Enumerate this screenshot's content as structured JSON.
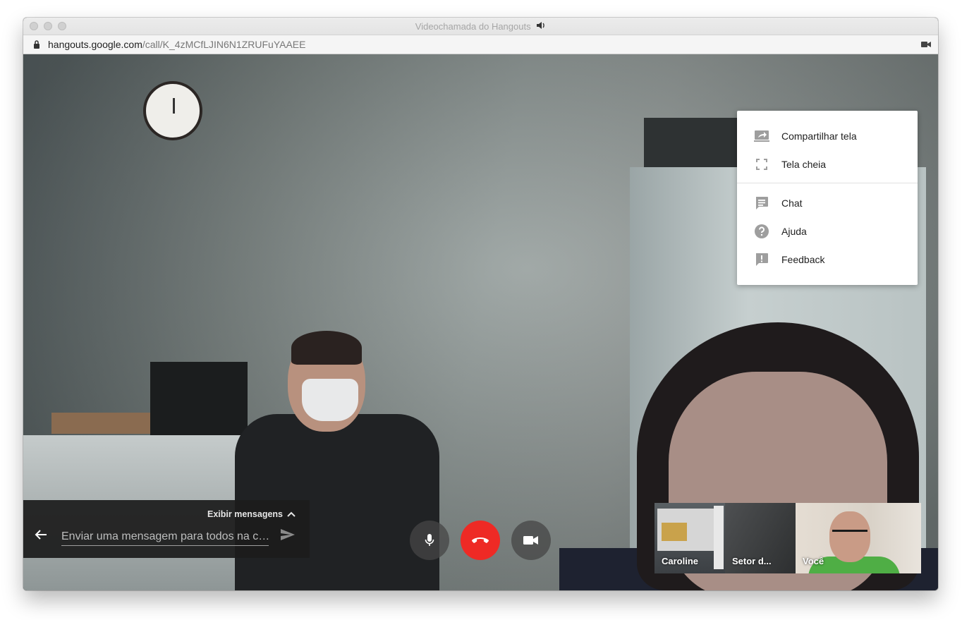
{
  "window": {
    "title": "Videochamada do Hangouts",
    "title_icon": "speaker-icon",
    "url_host": "hangouts.google.com",
    "url_path": "/call/K_4zMCfLJIN6N1ZRUFuYAAEE"
  },
  "menu": {
    "items": [
      {
        "label": "Compartilhar tela",
        "icon": "share-screen-icon"
      },
      {
        "label": "Tela cheia",
        "icon": "fullscreen-icon"
      },
      {
        "label": "Chat",
        "icon": "chat-icon"
      },
      {
        "label": "Ajuda",
        "icon": "help-icon"
      },
      {
        "label": "Feedback",
        "icon": "feedback-icon"
      }
    ]
  },
  "messages": {
    "toggle_label": "Exibir mensagens",
    "input_placeholder": "Enviar uma mensagem para todos na c…"
  },
  "call_controls": {
    "mic": "mic-icon",
    "hangup": "hangup-icon",
    "camera": "camera-icon",
    "hangup_color": "#ee2a25"
  },
  "participants": [
    {
      "name": "Caroline"
    },
    {
      "name": "Setor d..."
    },
    {
      "name": "Você"
    }
  ]
}
